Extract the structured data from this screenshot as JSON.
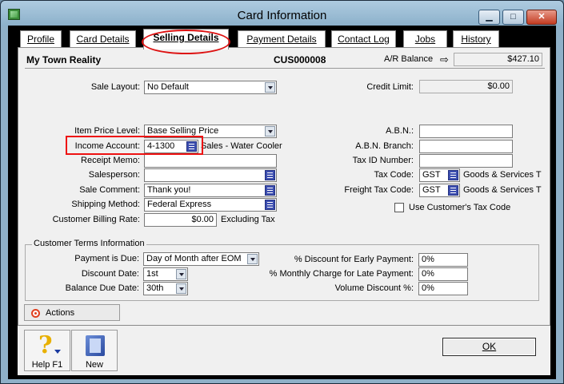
{
  "window": {
    "title": "Card Information"
  },
  "window_controls": {
    "minimize": "▁",
    "maximize": "□",
    "close": "✕"
  },
  "tabs": [
    {
      "label": "Profile"
    },
    {
      "label": "Card Details"
    },
    {
      "label": "Selling Details",
      "active": true
    },
    {
      "label": "Payment Details"
    },
    {
      "label": "Contact Log"
    },
    {
      "label": "Jobs"
    },
    {
      "label": "History"
    }
  ],
  "header": {
    "card_name": "My Town Reality",
    "card_id": "CUS000008",
    "balance_label": "A/R Balance",
    "balance_value": "$427.10"
  },
  "selling": {
    "sale_layout": {
      "label": "Sale Layout:",
      "value": "No Default"
    },
    "credit_limit": {
      "label": "Credit Limit:",
      "value": "$0.00"
    },
    "item_price_level": {
      "label": "Item Price Level:",
      "value": "Base Selling Price"
    },
    "income_account": {
      "label": "Income Account:",
      "value": "4-1300",
      "description": "Sales - Water Cooler"
    },
    "receipt_memo": {
      "label": "Receipt Memo:",
      "value": ""
    },
    "salesperson": {
      "label": "Salesperson:",
      "value": ""
    },
    "sale_comment": {
      "label": "Sale Comment:",
      "value": "Thank you!"
    },
    "shipping_method": {
      "label": "Shipping Method:",
      "value": "Federal Express"
    },
    "billing_rate": {
      "label": "Customer Billing Rate:",
      "value": "$0.00",
      "suffix": "Excluding Tax"
    },
    "abn": {
      "label": "A.B.N.:",
      "value": ""
    },
    "abn_branch": {
      "label": "A.B.N. Branch:",
      "value": ""
    },
    "tax_id": {
      "label": "Tax ID Number:",
      "value": ""
    },
    "tax_code": {
      "label": "Tax Code:",
      "value": "GST",
      "description": "Goods & Services T"
    },
    "freight_tax_code": {
      "label": "Freight Tax Code:",
      "value": "GST",
      "description": "Goods & Services T"
    },
    "use_customer_tax": {
      "label": "Use Customer's Tax Code",
      "checked": false
    }
  },
  "terms": {
    "group_label": "Customer Terms Information",
    "payment_due": {
      "label": "Payment is Due:",
      "value": "Day of Month after EOM"
    },
    "discount_date": {
      "label": "Discount Date:",
      "value": "1st"
    },
    "balance_due_date": {
      "label": "Balance Due Date:",
      "value": "30th"
    },
    "early_payment": {
      "label": "% Discount for Early Payment:",
      "value": "0%"
    },
    "late_payment": {
      "label": "% Monthly Charge for Late Payment:",
      "value": "0%"
    },
    "volume_discount": {
      "label": "Volume Discount %:",
      "value": "0%"
    }
  },
  "actions": {
    "label": "Actions"
  },
  "toolbar": {
    "help_label": "Help F1",
    "new_label": "New"
  },
  "ok": {
    "label": "OK"
  },
  "colors": {
    "highlight": "#e11111",
    "list_button": "#3d4fb0"
  }
}
